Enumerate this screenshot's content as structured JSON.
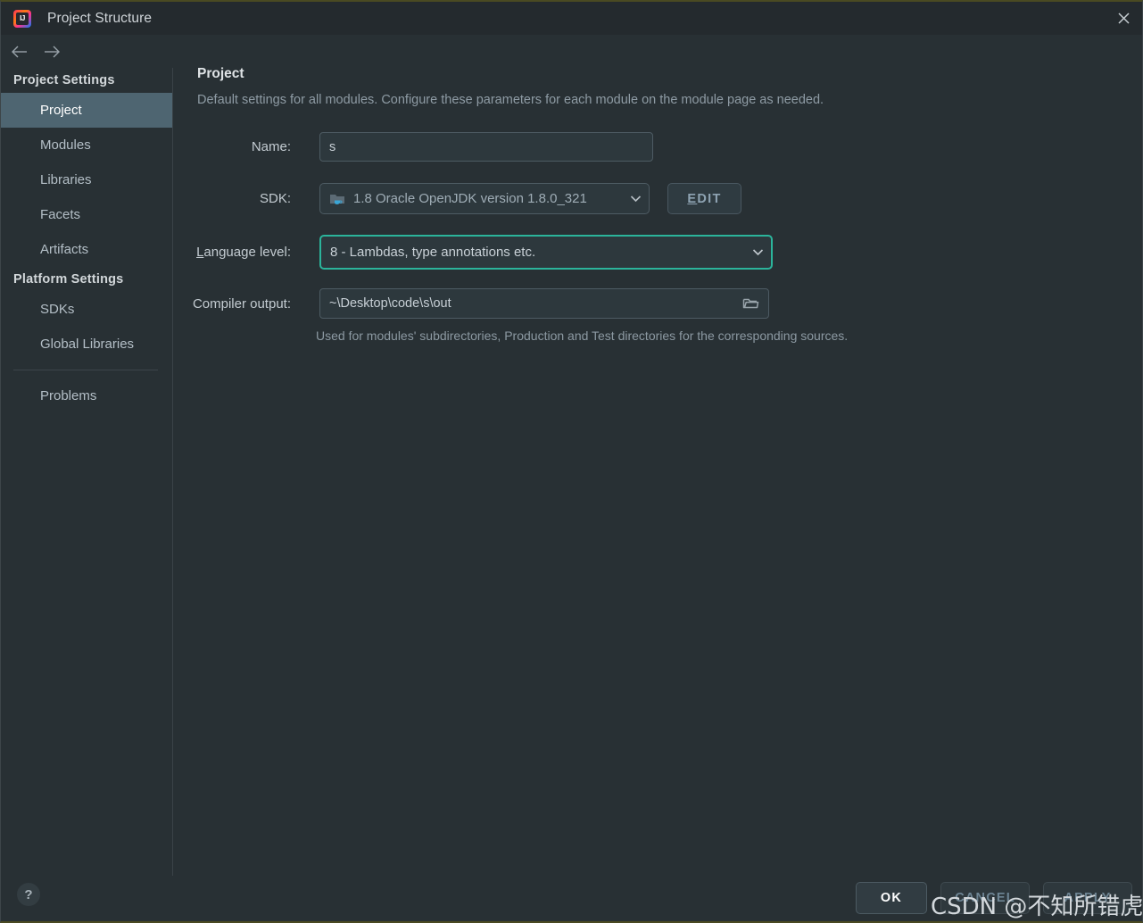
{
  "window": {
    "title": "Project Structure",
    "app_icon": "intellij-idea-icon",
    "close_icon": "close-icon",
    "border_accent": "#4a4a22"
  },
  "nav": {
    "back_icon": "arrow-left-icon",
    "forward_icon": "arrow-right-icon"
  },
  "sidebar": {
    "groups": [
      {
        "header": "Project Settings",
        "items": [
          {
            "label": "Project",
            "selected": true
          },
          {
            "label": "Modules",
            "selected": false
          },
          {
            "label": "Libraries",
            "selected": false
          },
          {
            "label": "Facets",
            "selected": false
          },
          {
            "label": "Artifacts",
            "selected": false
          }
        ]
      },
      {
        "header": "Platform Settings",
        "items": [
          {
            "label": "SDKs",
            "selected": false
          },
          {
            "label": "Global Libraries",
            "selected": false
          }
        ]
      }
    ],
    "footer_items": [
      {
        "label": "Problems",
        "selected": false
      }
    ],
    "selected_bg": "#4e6571"
  },
  "main": {
    "title": "Project",
    "subtitle": "Default settings for all modules. Configure these parameters for each module on the module page as needed.",
    "fields": {
      "name": {
        "label": "Name:",
        "value": "s",
        "placeholder": ""
      },
      "sdk": {
        "label": "SDK:",
        "value": "1.8 Oracle OpenJDK version 1.8.0_321",
        "icon": "jdk-folder-icon",
        "dropdown_icon": "chevron-down-icon",
        "edit_button": {
          "label": "EDIT",
          "mnemonic": "E"
        }
      },
      "language_level": {
        "label": "Language level:",
        "mnemonic": "L",
        "value": "8 - Lambdas, type annotations etc.",
        "dropdown_icon": "chevron-down-icon",
        "focused": true,
        "focus_color": "#2bb49b"
      },
      "compiler_output": {
        "label": "Compiler output:",
        "value": "~\\Desktop\\code\\s\\out",
        "browse_icon": "folder-open-icon",
        "hint": "Used for modules' subdirectories, Production and Test directories for the corresponding sources."
      }
    }
  },
  "footer": {
    "help_label": "?",
    "help_icon": "question-mark-icon",
    "buttons": [
      {
        "id": "ok",
        "label": "OK"
      },
      {
        "id": "cancel",
        "label": "CANCEL"
      },
      {
        "id": "apply",
        "label": "APPLY"
      }
    ]
  },
  "watermark": {
    "text": "CSDN @不知所错虎图图"
  }
}
